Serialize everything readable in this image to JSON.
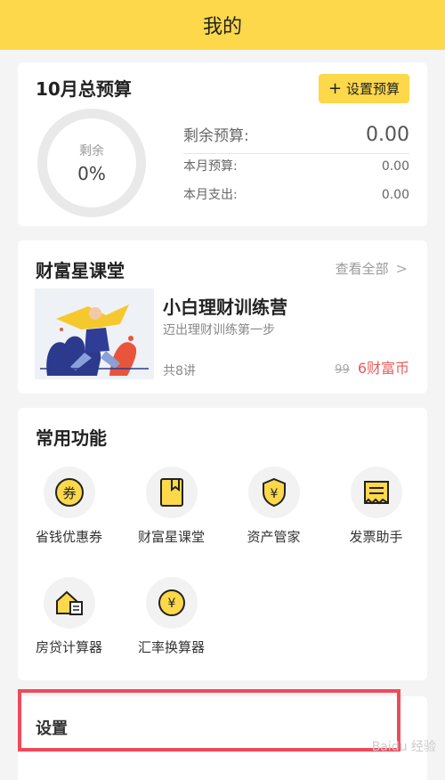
{
  "header": {
    "title": "我的"
  },
  "budget": {
    "title": "10月总预算",
    "set_button": "设置预算",
    "ring_label": "剩余",
    "ring_value": "0%",
    "remaining_label": "剩余预算:",
    "remaining_value": "0.00",
    "month_budget_label": "本月预算:",
    "month_budget_value": "0.00",
    "month_spend_label": "本月支出:",
    "month_spend_value": "0.00"
  },
  "course": {
    "title": "财富星课堂",
    "view_all": "查看全部",
    "item_title": "小白理财训练营",
    "item_subtitle": "迈出理财训练第一步",
    "lessons": "共8讲",
    "old_price": "99",
    "price": "6财富币"
  },
  "functions": {
    "title": "常用功能",
    "items": [
      {
        "label": "省钱优惠券",
        "icon": "coupon-icon"
      },
      {
        "label": "财富星课堂",
        "icon": "book-icon"
      },
      {
        "label": "资产管家",
        "icon": "shield-yen-icon"
      },
      {
        "label": "发票助手",
        "icon": "receipt-icon"
      },
      {
        "label": "房贷计算器",
        "icon": "house-calculator-icon"
      },
      {
        "label": "汇率换算器",
        "icon": "yen-exchange-icon"
      }
    ]
  },
  "settings": {
    "title": "设置"
  },
  "watermark": "Baidu 经验",
  "colors": {
    "accent": "#fcd84a",
    "highlight": "#ef4a5a",
    "price": "#e95b5b"
  }
}
